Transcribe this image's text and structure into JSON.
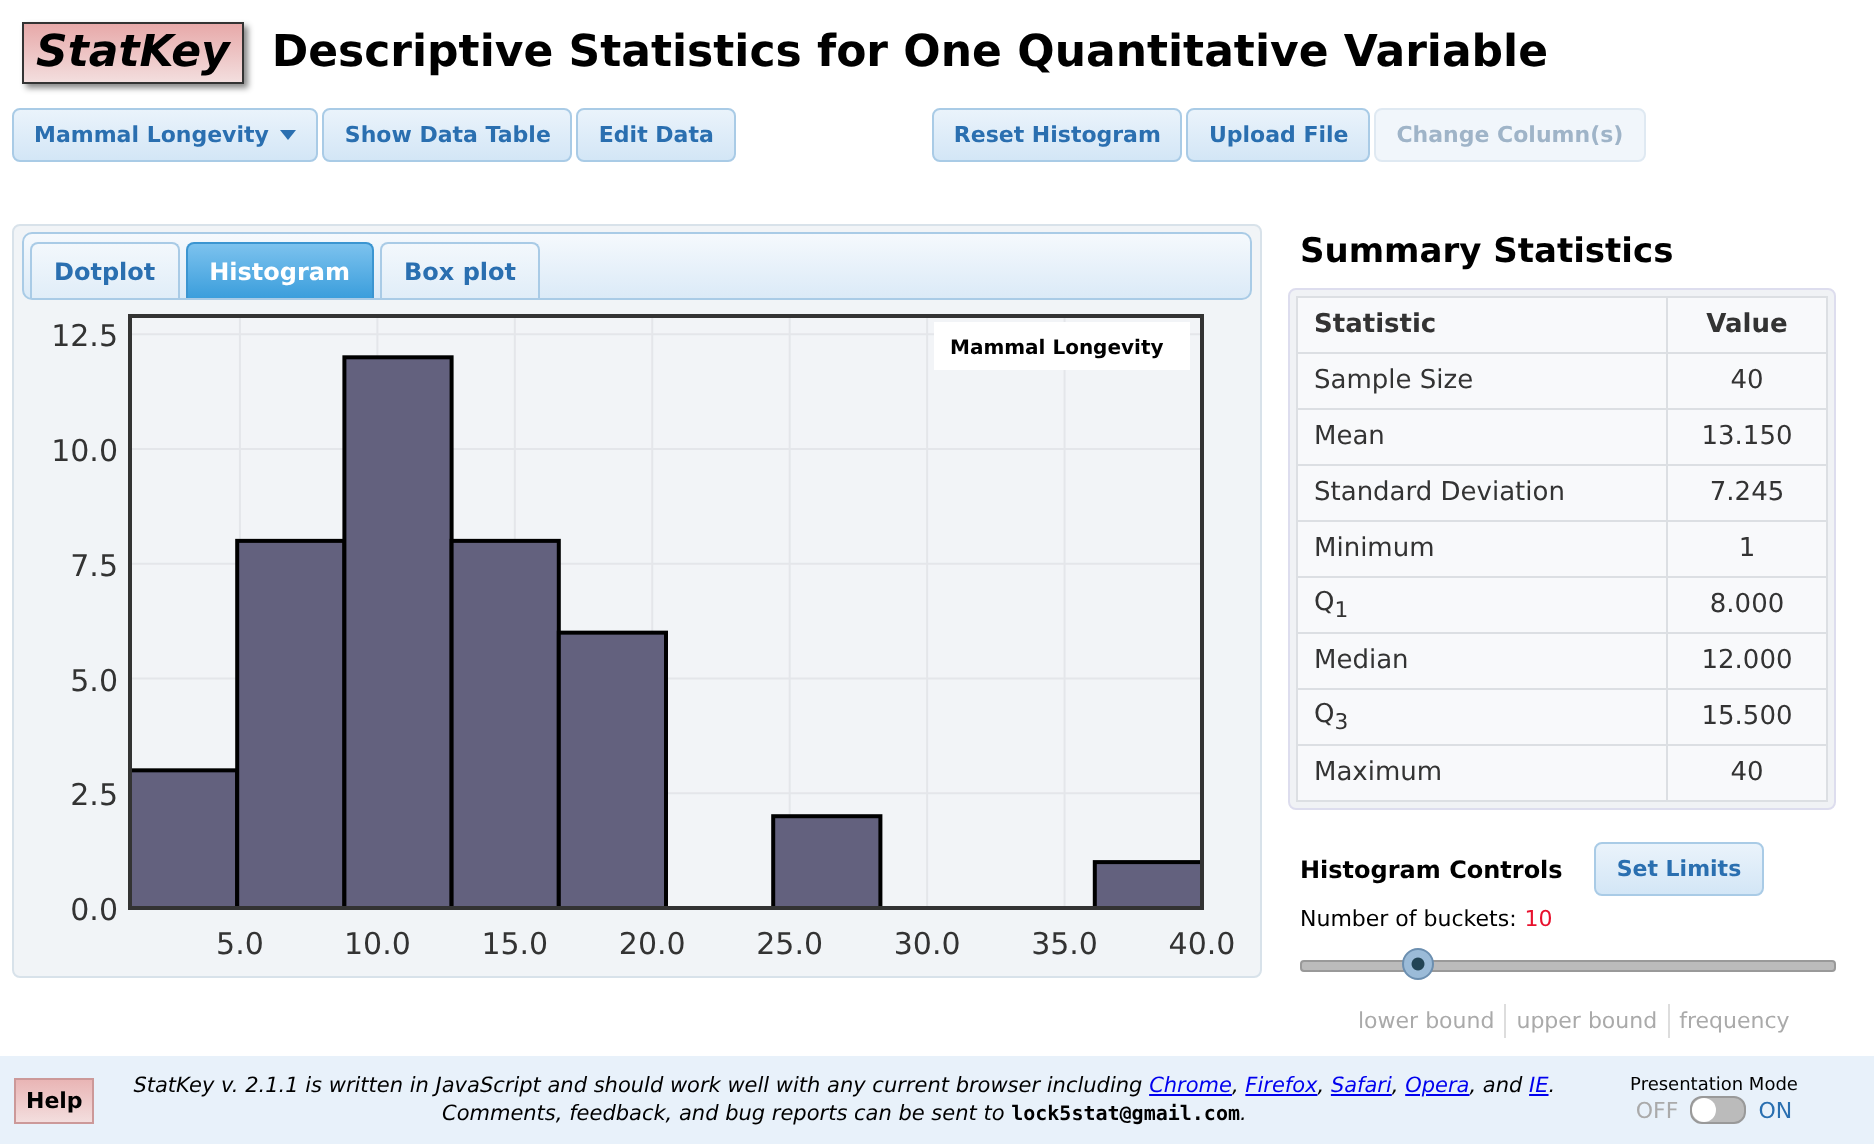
{
  "logo": "StatKey",
  "title": "Descriptive Statistics for One Quantitative Variable",
  "toolbar": [
    {
      "label": "Mammal Longevity",
      "kind": "dropdown",
      "disabled": false
    },
    {
      "label": "Show Data Table",
      "kind": "button",
      "disabled": false
    },
    {
      "label": "Edit Data",
      "kind": "button",
      "disabled": false
    },
    {
      "label": "Reset Histogram",
      "kind": "button",
      "disabled": false
    },
    {
      "label": "Upload File",
      "kind": "button",
      "disabled": false
    },
    {
      "label": "Change Column(s)",
      "kind": "button",
      "disabled": true
    }
  ],
  "tabs": [
    {
      "label": "Dotplot",
      "selected": false
    },
    {
      "label": "Histogram",
      "selected": true
    },
    {
      "label": "Box plot",
      "selected": false
    }
  ],
  "chart": {
    "chart_data": {
      "type": "bar",
      "grid": true,
      "x": [
        2.95,
        6.85,
        10.75,
        14.65,
        18.55,
        22.45,
        26.35,
        30.25,
        34.15,
        38.05
      ],
      "series": [
        {
          "name": "Mammal Longevity",
          "color": "#63617e",
          "values": [
            3,
            8,
            12,
            8,
            6,
            0,
            2,
            0,
            0,
            1
          ]
        }
      ],
      "xlim": [
        1,
        40
      ],
      "ylim": [
        0,
        12.9
      ],
      "xticks": [
        {
          "value": 5,
          "label": "5.0"
        },
        {
          "value": 10,
          "label": "10.0"
        },
        {
          "value": 15,
          "label": "15.0"
        },
        {
          "value": 20,
          "label": "20.0"
        },
        {
          "value": 25,
          "label": "25.0"
        },
        {
          "value": 30,
          "label": "30.0"
        },
        {
          "value": 35,
          "label": "35.0"
        },
        {
          "value": 40,
          "label": "40.0"
        }
      ],
      "yticks": [
        {
          "value": 0,
          "label": "0.0"
        },
        {
          "value": 2.5,
          "label": "2.5"
        },
        {
          "value": 5,
          "label": "5.0"
        },
        {
          "value": 7.5,
          "label": "7.5"
        },
        {
          "value": 10,
          "label": "10.0"
        },
        {
          "value": 12.5,
          "label": "12.5"
        }
      ]
    }
  },
  "summary": {
    "title": "Summary Statistics",
    "columns": [
      "Statistic",
      "Value"
    ],
    "rows": [
      [
        "Sample Size",
        "40"
      ],
      [
        "Mean",
        "13.150"
      ],
      [
        "Standard Deviation",
        "7.245"
      ],
      [
        "Minimum",
        "1"
      ],
      [
        "Q$_{1}$",
        "8.000"
      ],
      [
        "Median",
        "12.000"
      ],
      [
        "Q$_{3}$",
        "15.500"
      ],
      [
        "Maximum",
        "40"
      ]
    ]
  },
  "histogram_controls": {
    "title": "Histogram Controls",
    "button": "Set Limits",
    "buckets_label": "Number of buckets:",
    "buckets_value": "10",
    "level": 0.22
  },
  "frequency_table": {
    "columns": [
      "lower bound",
      "upper bound",
      "frequency"
    ]
  },
  "footer": {
    "help": "Help",
    "line1": [
      "StatKey v. 2.1.1 is written in JavaScript and should work well with any current browser including ",
      {
        "link": "Chrome"
      },
      ", ",
      {
        "link": "Firefox"
      },
      ", ",
      {
        "link": "Safari"
      },
      ", ",
      {
        "link": "Opera"
      },
      ", and ",
      {
        "link": "IE"
      },
      "."
    ],
    "line2": "Comments, feedback, and bug reports can be sent to ",
    "email": "lock5stat@gmail.com",
    "line2_end": ".",
    "presentation": {
      "label": "Presentation Mode",
      "off": "OFF",
      "on_label": "ON",
      "on": false
    }
  }
}
